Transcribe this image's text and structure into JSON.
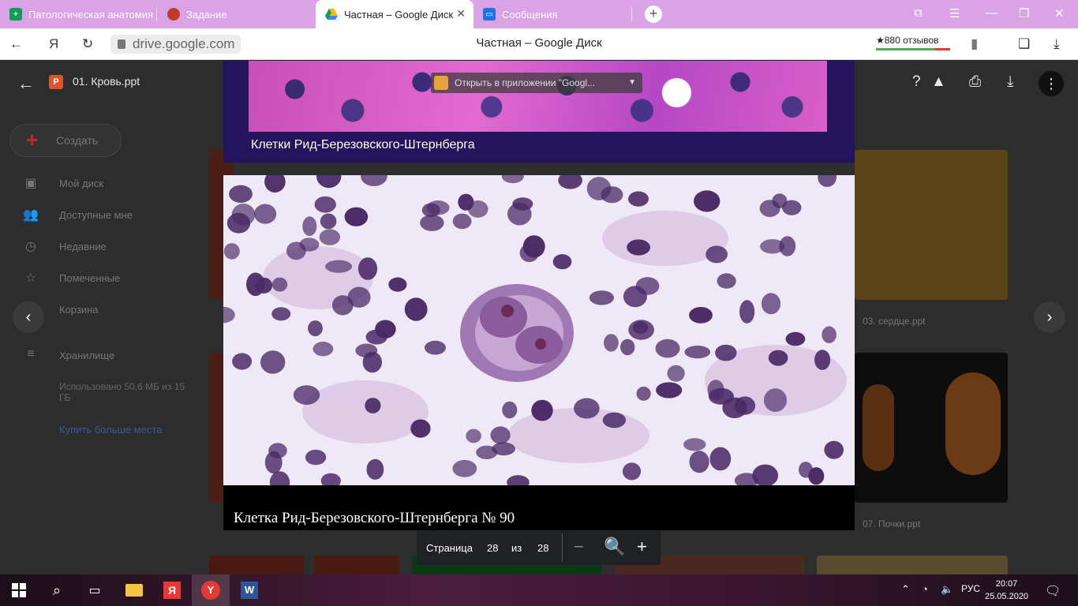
{
  "tabs": [
    {
      "title": "Патологическая анатомия",
      "favicon": "sheets-icon",
      "color": "#0f9d58"
    },
    {
      "title": "Задание",
      "favicon": "task-icon",
      "color": "#c0392b"
    },
    {
      "title": "Частная – Google Диск",
      "favicon": "drive-icon",
      "color": "#fbbc04",
      "active": true
    },
    {
      "title": "Сообщения",
      "favicon": "messages-icon",
      "color": "#1a73e8"
    }
  ],
  "address_bar": {
    "url": "drive.google.com",
    "page_title": "Частная – Google Диск",
    "reviews": "★880 отзывов"
  },
  "drive": {
    "file_name": "01. Кровь.ppt",
    "create_label": "Создать",
    "nav": [
      {
        "label": "Мой диск",
        "icon": "drive-icon"
      },
      {
        "label": "Доступные мне",
        "icon": "shared-icon"
      },
      {
        "label": "Недавние",
        "icon": "clock-icon"
      },
      {
        "label": "Помеченные",
        "icon": "star-icon"
      },
      {
        "label": "Корзина",
        "icon": "trash-icon"
      }
    ],
    "storage_label": "Хранилище",
    "storage_used": "Использовано 50,6 МБ из 15 ГБ",
    "buy_more": "Купить больше места",
    "files": [
      {
        "name": "03. сердце.ppt"
      },
      {
        "name": "07. Почки.ppt"
      }
    ]
  },
  "viewer": {
    "open_in_app": "Открыть в приложении \"Googl...",
    "slide_prev_caption": "Клетки Рид-Березовского-Штернберга",
    "slide_caption": "Клетка Рид-Березовского-Штернберга № 90",
    "page_label": "Страница",
    "page_current": "28",
    "page_of": "из",
    "page_total": "28"
  },
  "taskbar": {
    "language": "РУС",
    "time": "20:07",
    "date": "25.05.2020"
  }
}
